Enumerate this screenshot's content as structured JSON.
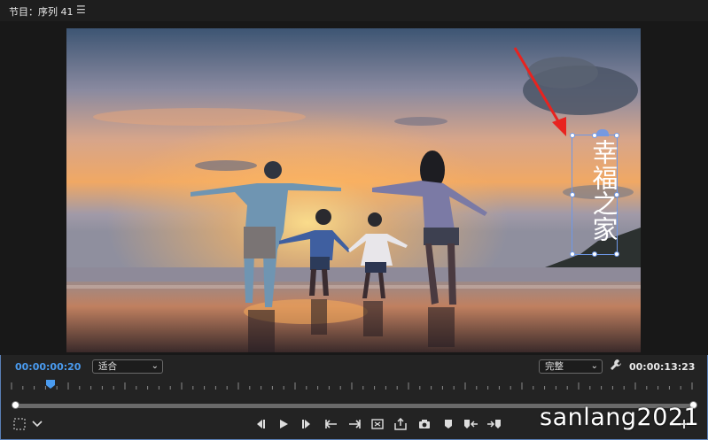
{
  "panel": {
    "title": "节目：序列 41",
    "menu_icon": "hamburger-menu-icon"
  },
  "program_monitor": {
    "frame_description_icon": "video-frame",
    "title_graphic": {
      "text": "幸福之家",
      "color": "#ffffff"
    },
    "annotation_arrow_color": "#e8231f"
  },
  "info_bar": {
    "current_timecode": "00:00:00:20",
    "zoom_dropdown": {
      "selected": "适合"
    },
    "quality_dropdown": {
      "selected": "完整"
    },
    "duration_timecode": "00:00:13:23",
    "settings_icon": "wrench-icon"
  },
  "timeline": {
    "playhead_position_fraction": 0.056
  },
  "transport_controls": [
    {
      "name": "mark-in-button",
      "icon": "mark-in-icon"
    },
    {
      "name": "mark-out-button",
      "icon": "mark-out-icon"
    },
    {
      "name": "go-to-in-button",
      "icon": "go-to-in-icon"
    },
    {
      "name": "step-back-button",
      "icon": "step-back-icon"
    },
    {
      "name": "play-button",
      "icon": "play-icon"
    },
    {
      "name": "step-forward-button",
      "icon": "step-forward-icon"
    },
    {
      "name": "go-to-out-button",
      "icon": "go-to-out-icon"
    },
    {
      "name": "insert-button",
      "icon": "insert-icon"
    },
    {
      "name": "overwrite-button",
      "icon": "overwrite-icon"
    },
    {
      "name": "export-frame-button",
      "icon": "camera-icon"
    },
    {
      "name": "add-marker-button",
      "icon": "marker-icon"
    },
    {
      "name": "lift-button",
      "icon": "lift-icon"
    },
    {
      "name": "extract-button",
      "icon": "extract-icon"
    },
    {
      "name": "button-editor",
      "icon": "plus-icon"
    }
  ],
  "watermark": "sanlang2021",
  "colors": {
    "accent_blue": "#4a9bef",
    "selection_blue": "#6e98e8",
    "background": "#232323"
  }
}
